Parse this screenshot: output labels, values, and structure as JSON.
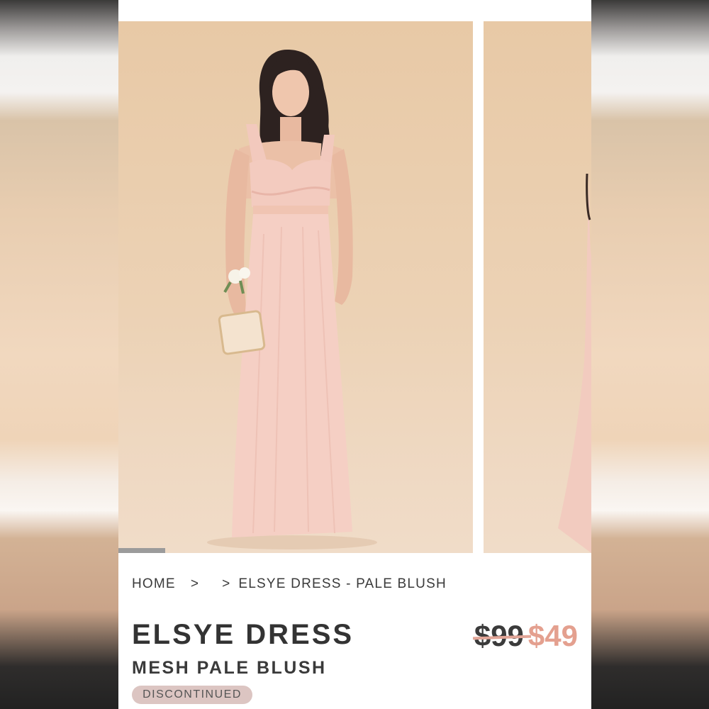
{
  "breadcrumb": {
    "home": "HOME",
    "separator": ">",
    "current": "ELSYE DRESS - PALE BLUSH"
  },
  "product": {
    "name": "ELSYE DRESS",
    "variant": "MESH PALE BLUSH",
    "price_original": "$99",
    "price_sale": "$49",
    "status_badge": "DISCONTINUED"
  },
  "carousel": {
    "slides": [
      "model-front-photo",
      "model-side-photo"
    ],
    "active_index": 0
  },
  "colors": {
    "dress_blush": "#f2c9bd",
    "backdrop": "#e8cbaa",
    "sale_price": "#e4a08f",
    "badge_bg": "#dcc5c2"
  }
}
